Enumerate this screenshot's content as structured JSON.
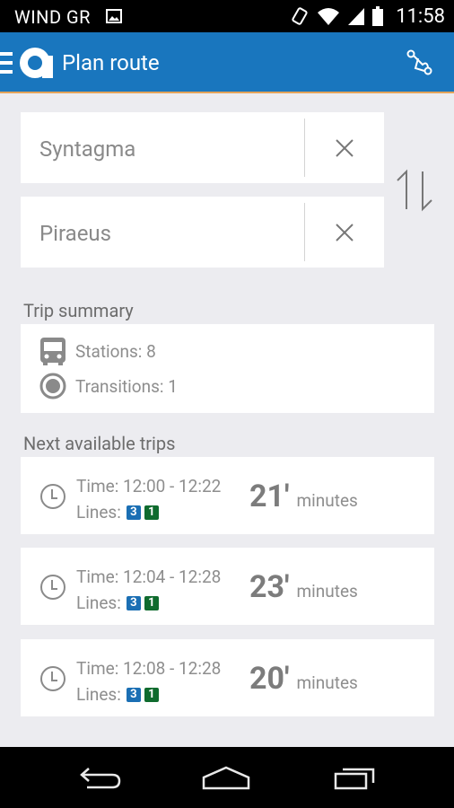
{
  "status_bar": {
    "carrier": "WIND GR",
    "time": "11:58"
  },
  "action_bar": {
    "title": "Plan route"
  },
  "route": {
    "from": "Syntagma",
    "to": "Piraeus"
  },
  "summary": {
    "heading": "Trip summary",
    "stations": "Stations: 8",
    "transitions": "Transitions: 1"
  },
  "trips_heading": "Next available trips",
  "trips": [
    {
      "time": "Time: 12:00 - 12:22",
      "lines_label": "Lines:",
      "line1": "3",
      "line2": "1",
      "duration": "21′",
      "unit": "minutes"
    },
    {
      "time": "Time: 12:04 - 12:28",
      "lines_label": "Lines:",
      "line1": "3",
      "line2": "1",
      "duration": "23′",
      "unit": "minutes"
    },
    {
      "time": "Time: 12:08 - 12:28",
      "lines_label": "Lines:",
      "line1": "3",
      "line2": "1",
      "duration": "20′",
      "unit": "minutes"
    }
  ],
  "colors": {
    "action_bar": "#1976be",
    "accent_line": "#e2a35a",
    "line3_badge": "#1b6fb4",
    "line1_badge": "#0f6b2e"
  }
}
